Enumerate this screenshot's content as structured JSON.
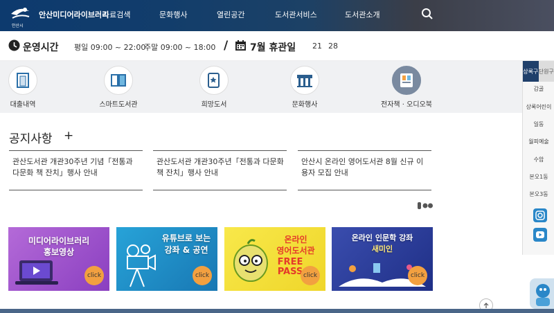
{
  "header": {
    "logo_text": "안산시",
    "site_name": "안산미디어라이브러리",
    "nav": [
      "자료검색",
      "문화행사",
      "열린공간",
      "도서관서비스",
      "도서관소개"
    ]
  },
  "hours": {
    "title": "운영시간",
    "weekday": "평일 09:00 ~ 22:00",
    "weekend": "주말 09:00 ~ 18:00",
    "slash": "/",
    "closed_title": "7월 휴관일",
    "dates": [
      "21",
      "28"
    ]
  },
  "quick_menu": [
    {
      "label": "대출내역",
      "icon": "loan-icon"
    },
    {
      "label": "스마트도서관",
      "icon": "smart-library-icon"
    },
    {
      "label": "희망도서",
      "icon": "wish-book-icon"
    },
    {
      "label": "문화행사",
      "icon": "culture-event-icon"
    },
    {
      "label": "전자책 · 오디오북",
      "icon": "ebook-icon"
    }
  ],
  "side": {
    "tabs": [
      "상록구",
      "단원구"
    ],
    "links": [
      "감골",
      "상록어린이",
      "일동",
      "월피예술",
      "수암",
      "본오1동",
      "본오3동"
    ],
    "sns": [
      "instagram-icon",
      "youtube-icon"
    ]
  },
  "notice": {
    "title": "공지사항",
    "plus": "+",
    "items": [
      "관산도서관 개관30주년 기념「전통과 다문화 책 잔치」행사 안내",
      "관산도서관 개관30주년「전통과 다문화 책 잔치」행사 안내",
      "안산시 온라인 영어도서관 8월 신규 이용자 모집 안내"
    ]
  },
  "banners": [
    {
      "lines": [
        "미디어라이브러리",
        "홍보영상"
      ],
      "click": "click",
      "color": "#9b53c7"
    },
    {
      "lines": [
        "유튜브로 보는",
        "강좌 & 공연"
      ],
      "click": "click",
      "color": "#1e8ac4"
    },
    {
      "lines": [
        "온라인",
        "영어도서관"
      ],
      "extra": "FREE PASS",
      "click": "click",
      "color": "#f3df37"
    },
    {
      "lines": [
        "온라인 인문학 강좌",
        "새미인"
      ],
      "click": "click",
      "color": "#2a3d9a"
    }
  ],
  "colors": {
    "header": "#123d6b",
    "accent": "#1f3f6a",
    "click": "#f2a040"
  }
}
